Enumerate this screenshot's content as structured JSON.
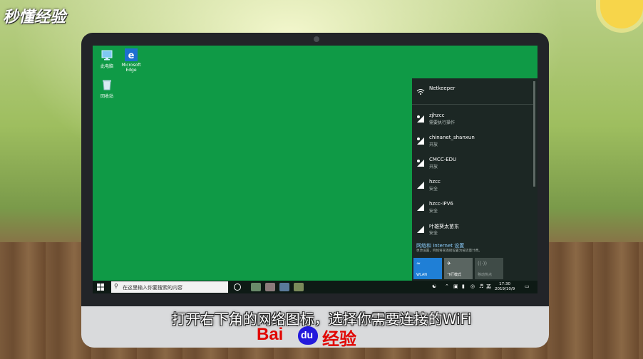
{
  "brand": {
    "logo_text": "秒懂经验"
  },
  "desktop": {
    "icons": [
      {
        "label": "此电脑"
      },
      {
        "label": "Microsoft Edge"
      },
      {
        "label": "回收站"
      }
    ]
  },
  "wifi_panel": {
    "networks": [
      {
        "name": "Netkeeper",
        "status": ""
      },
      {
        "name": "zjhzcc",
        "status": "需要执行操作"
      },
      {
        "name": "chinanet_shanxun",
        "status": "开放"
      },
      {
        "name": "CMCC-EDU",
        "status": "开放"
      },
      {
        "name": "hzcc",
        "status": "安全"
      },
      {
        "name": "hzcc-IPV6",
        "status": "安全"
      },
      {
        "name": "叶雄葵太苗东",
        "status": "安全"
      }
    ],
    "settings_link": "网络和 Internet 设置",
    "settings_desc": "更改设置，例如将某连接设置为按流量计费。",
    "tiles": [
      {
        "label": "WLAN",
        "color": "#1f7fd6"
      },
      {
        "label": "飞行模式",
        "color": "#5a6561"
      },
      {
        "label": "移动热点",
        "color": "#3f4b47"
      }
    ]
  },
  "taskbar": {
    "search_placeholder": "在这里输入你要搜索的内容",
    "ime": "英",
    "time": "17:30",
    "date": "2019/10/9"
  },
  "caption": {
    "subtitle": "打开右下角的网络图标，选择你需要连接的WiFi"
  },
  "footer": {
    "baidu_a": "Bai",
    "baidu_b": "du",
    "baidu_c": "经验"
  }
}
